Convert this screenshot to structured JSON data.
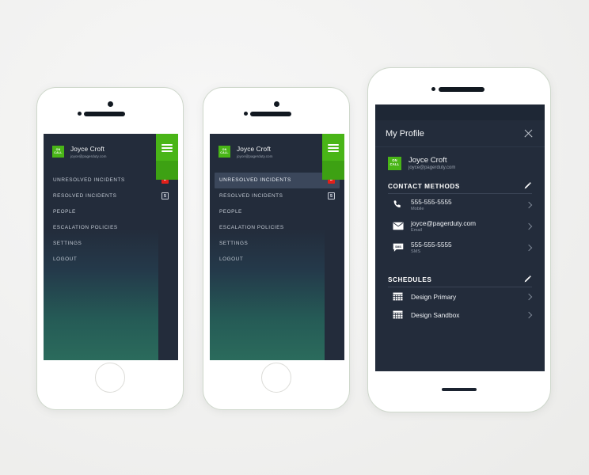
{
  "theme": {
    "page_bg": "#f2f2f1",
    "screen_dark": "#232c3b",
    "accent_green": "#49b517",
    "accent_green_dark": "#3da113",
    "badge_red": "#e0201a",
    "active_row": "#3b475b",
    "gradient_bottom": "#2b6b5c"
  },
  "menu": {
    "user": {
      "name": "Joyce Croft",
      "email": "joyce@pagerduty.com",
      "status_badge_line1": "ON",
      "status_badge_line2": "CALL",
      "chevron_icon": "chevron-down-icon"
    },
    "hamburger_icon": "hamburger-menu-icon",
    "items": [
      {
        "label": "UNRESOLVED INCIDENTS",
        "badge": "2",
        "badge_style": "red",
        "active_in_screen_2": true
      },
      {
        "label": "RESOLVED INCIDENTS",
        "badge": "5",
        "badge_style": "neutral",
        "active_in_screen_2": false
      },
      {
        "label": "PEOPLE",
        "badge": "",
        "badge_style": "",
        "active_in_screen_2": false
      },
      {
        "label": "ESCALATION POLICIES",
        "badge": "",
        "badge_style": "",
        "active_in_screen_2": false
      },
      {
        "label": "SETTINGS",
        "badge": "",
        "badge_style": "",
        "active_in_screen_2": false
      },
      {
        "label": "LOGOUT",
        "badge": "",
        "badge_style": "",
        "active_in_screen_2": false
      }
    ]
  },
  "profile": {
    "header": {
      "title": "My Profile",
      "close_icon": "close-icon"
    },
    "user": {
      "name": "Joyce Croft",
      "email": "joyce@pagerduty.com",
      "status_badge_line1": "ON",
      "status_badge_line2": "CALL"
    },
    "contact_methods": {
      "title": "CONTACT METHODS",
      "edit_icon": "pencil-edit-icon",
      "items": [
        {
          "value": "555-555-5555",
          "type": "Mobile",
          "icon": "phone-icon"
        },
        {
          "value": "joyce@pagerduty.com",
          "type": "Email",
          "icon": "envelope-icon"
        },
        {
          "value": "555-555-5555",
          "type": "SMS",
          "icon": "sms-bubble-icon"
        }
      ]
    },
    "schedules": {
      "title": "SCHEDULES",
      "edit_icon": "pencil-edit-icon",
      "items": [
        {
          "name": "Design Primary",
          "icon": "calendar-grid-icon"
        },
        {
          "name": "Design Sandbox",
          "icon": "calendar-grid-icon"
        }
      ]
    }
  }
}
